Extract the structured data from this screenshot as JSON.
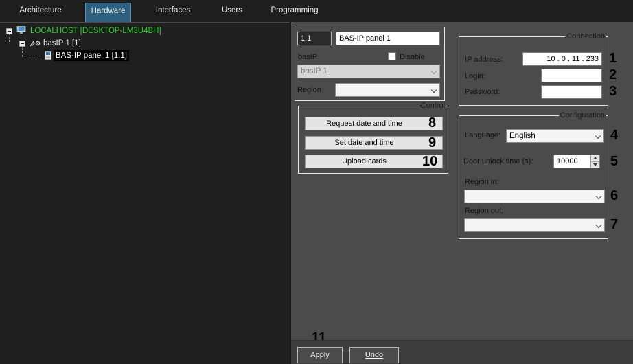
{
  "tabs": [
    {
      "label": "Architecture",
      "active": false
    },
    {
      "label": "Hardware",
      "active": true
    },
    {
      "label": "Interfaces",
      "active": false
    },
    {
      "label": "Users",
      "active": false
    },
    {
      "label": "Programming",
      "active": false
    }
  ],
  "tree": {
    "root": "LOCALHOST [DESKTOP-LM3U4BH]",
    "child": "basIP 1 [1]",
    "leaf": "BAS-IP panel 1 [1.1]",
    "root_color": "#2ecc2e"
  },
  "device": {
    "id": "1.1",
    "name": "BAS-IP panel 1",
    "type_label": "basIP",
    "disable_label": "Disable",
    "parent_combo": "basIP 1",
    "region_label": "Region",
    "region_value": ""
  },
  "control": {
    "title": "Control",
    "request_date": "Request date and time",
    "set_date": "Set date and time",
    "upload_cards": "Upload cards"
  },
  "connection": {
    "title": "Connection",
    "ip_label": "IP address:",
    "ip_value": "10 . 0 . 11 . 233",
    "login_label": "Login:",
    "login_value": "",
    "password_label": "Password:",
    "password_value": ""
  },
  "configuration": {
    "title": "Configuration",
    "language_label": "Language:",
    "language_value": "English",
    "door_label": "Door unlock time (s):",
    "door_value": "10000",
    "region_in_label": "Region in:",
    "region_in_value": "",
    "region_out_label": "Region out:",
    "region_out_value": ""
  },
  "callouts": [
    "1",
    "2",
    "3",
    "4",
    "5",
    "6",
    "7",
    "8",
    "9",
    "10",
    "11"
  ],
  "footer": {
    "apply": "Apply",
    "undo": "Undo"
  }
}
